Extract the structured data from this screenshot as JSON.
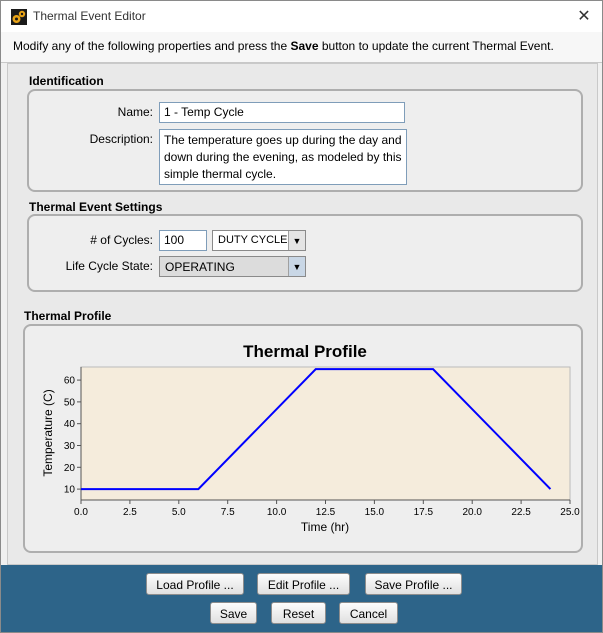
{
  "window": {
    "title": "Thermal Event Editor",
    "close_symbol": "✕"
  },
  "instructions": {
    "prefix": "Modify any of the following properties and press the ",
    "bold": "Save",
    "suffix": " button to update the current Thermal Event."
  },
  "identification": {
    "section_title": "Identification",
    "name_label": "Name:",
    "name_value": "1 - Temp Cycle",
    "description_label": "Description:",
    "description_value": "The temperature goes up during the day and down during the evening, as modeled by this simple thermal cycle."
  },
  "settings": {
    "section_title": "Thermal Event Settings",
    "cycles_label": "# of Cycles:",
    "cycles_value": "100",
    "cycle_unit": "DUTY CYCLE",
    "life_cycle_label": "Life Cycle State:",
    "life_cycle_value": "OPERATING"
  },
  "profile": {
    "section_title": "Thermal Profile"
  },
  "chart_data": {
    "type": "line",
    "title": "Thermal Profile",
    "xlabel": "Time (hr)",
    "ylabel": "Temperature (C)",
    "xlim": [
      0,
      25
    ],
    "ylim": [
      5,
      66
    ],
    "xticks": [
      "0.0",
      "2.5",
      "5.0",
      "7.5",
      "10.0",
      "12.5",
      "15.0",
      "17.5",
      "20.0",
      "22.5",
      "25.0"
    ],
    "yticks": [
      "10",
      "20",
      "30",
      "40",
      "50",
      "60"
    ],
    "x": [
      0,
      6,
      12,
      18,
      24
    ],
    "y": [
      10,
      10,
      65,
      65,
      10
    ],
    "line_color": "#0000ff",
    "plot_background": "#f5ecdc",
    "grid": false
  },
  "buttons": {
    "load_profile": "Load Profile ...",
    "edit_profile": "Edit Profile ...",
    "save_profile": "Save Profile ...",
    "save": "Save",
    "reset": "Reset",
    "cancel": "Cancel"
  },
  "colors": {
    "bottom_bar": "#2d6489",
    "accent_icon": "#e8a317"
  },
  "icons": {
    "app": "gears-icon",
    "close": "close-icon",
    "dropdown": "chevron-down-icon"
  }
}
